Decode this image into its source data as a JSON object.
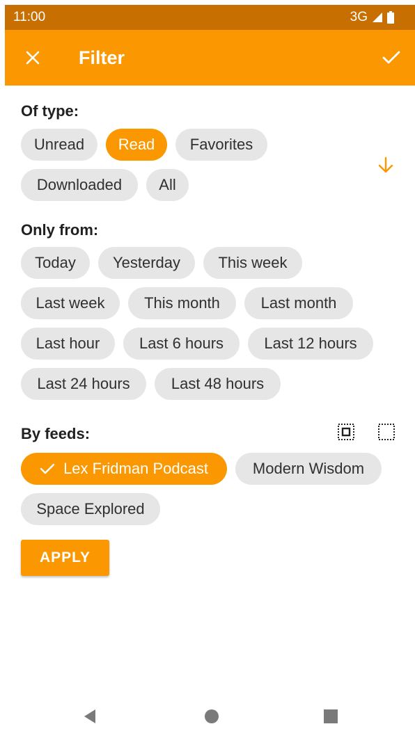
{
  "status_bar": {
    "time": "11:00",
    "network": "3G"
  },
  "app_bar": {
    "title": "Filter",
    "icons": {
      "close": "close-icon",
      "confirm": "check-icon"
    }
  },
  "sections": {
    "type": {
      "label": "Of type:",
      "chips": [
        {
          "label": "Unread",
          "selected": false
        },
        {
          "label": "Read",
          "selected": true
        },
        {
          "label": "Favorites",
          "selected": false
        },
        {
          "label": "Downloaded",
          "selected": false
        },
        {
          "label": "All",
          "selected": false
        }
      ],
      "sort_icon": "arrow-down-icon"
    },
    "date": {
      "label": "Only from:",
      "chips": [
        {
          "label": "Today",
          "selected": false
        },
        {
          "label": "Yesterday",
          "selected": false
        },
        {
          "label": "This week",
          "selected": false
        },
        {
          "label": "Last week",
          "selected": false
        },
        {
          "label": "This month",
          "selected": false
        },
        {
          "label": "Last month",
          "selected": false
        },
        {
          "label": "Last hour",
          "selected": false
        },
        {
          "label": "Last 6 hours",
          "selected": false
        },
        {
          "label": "Last 12 hours",
          "selected": false
        },
        {
          "label": "Last 24 hours",
          "selected": false
        },
        {
          "label": "Last 48 hours",
          "selected": false
        }
      ]
    },
    "feeds": {
      "label": "By feeds:",
      "chips": [
        {
          "label": "Lex Fridman Podcast",
          "selected": true
        },
        {
          "label": "Modern Wisdom",
          "selected": false
        },
        {
          "label": "Space Explored",
          "selected": false
        }
      ],
      "icons": {
        "select_all": "select-all-icon",
        "deselect_all": "deselect-all-icon"
      }
    }
  },
  "apply_button": {
    "label": "APPLY"
  },
  "colors": {
    "accent": "#fb9700",
    "status_bar": "#c76f00",
    "chip_bg": "#e6e6e6"
  },
  "nav_bar": {
    "icons": [
      "back-icon",
      "home-icon",
      "recents-icon"
    ]
  }
}
